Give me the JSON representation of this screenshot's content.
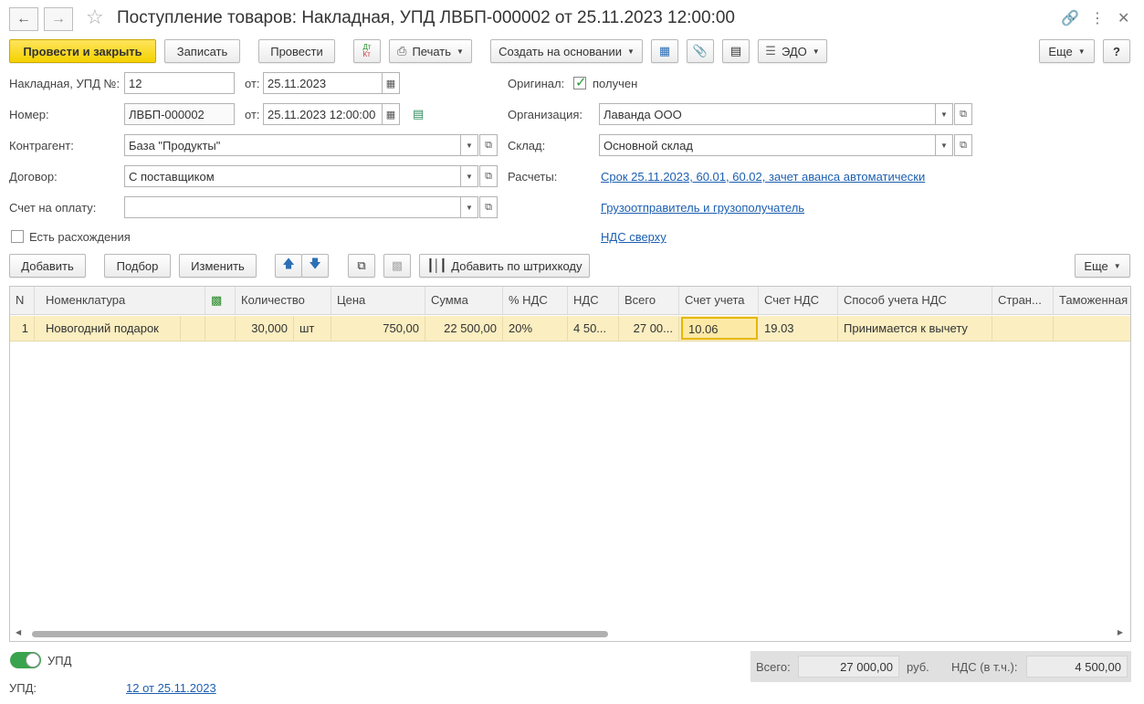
{
  "window": {
    "title": "Поступление товаров: Накладная, УПД ЛВБП-000002 от 25.11.2023 12:00:00",
    "back_icon": "arrow-left-icon",
    "forward_icon": "arrow-right-icon",
    "star_icon": "star-icon",
    "link_icon": "link-icon",
    "more_icon": "kebab-menu-icon",
    "close_icon": "close-icon"
  },
  "toolbar": {
    "post_close": "Провести и закрыть",
    "save": "Записать",
    "post": "Провести",
    "dtkt_icon": "dt-kt-icon",
    "print": "Печать",
    "create_based": "Создать на основании",
    "edo": "ЭДО",
    "more": "Еще",
    "help": "?",
    "accent": "#f5d200"
  },
  "form": {
    "invoice_label": "Накладная, УПД №:",
    "invoice_no": "12",
    "from_label": "от:",
    "invoice_date": "25.11.2023",
    "number_label": "Номер:",
    "number_value": "ЛВБП-000002",
    "doc_datetime": "25.11.2023 12:00:00",
    "contractor_label": "Контрагент:",
    "contractor_value": "База \"Продукты\"",
    "contract_label": "Договор:",
    "contract_value": "С поставщиком",
    "pay_invoice_label": "Счет на оплату:",
    "pay_invoice_value": "",
    "discrepancies_label": "Есть расхождения",
    "original_label": "Оригинал:",
    "received_label": "получен",
    "org_label": "Организация:",
    "org_value": "Лаванда ООО",
    "warehouse_label": "Склад:",
    "warehouse_value": "Основной склад",
    "settlements_label": "Расчеты:",
    "settlements_link": "Срок 25.11.2023, 60.01, 60.02, зачет аванса автоматически",
    "shipper_link": "Грузоотправитель и грузополучатель",
    "vat_link": "НДС сверху"
  },
  "table_toolbar": {
    "add": "Добавить",
    "select": "Подбор",
    "change": "Изменить",
    "barcode": "Добавить по штрихкоду",
    "more": "Еще"
  },
  "table": {
    "headers": [
      "N",
      "Номенклатура",
      "",
      "Количество",
      "",
      "Цена",
      "Сумма",
      "% НДС",
      "НДС",
      "Всего",
      "Счет учета",
      "Счет НДС",
      "Способ учета НДС",
      "Стран...",
      "Таможенная"
    ],
    "rows": [
      [
        "1",
        "Новогодний подарок",
        "",
        "30,000",
        "шт",
        "750,00",
        "22 500,00",
        "20%",
        "4 50...",
        "27 00...",
        "10.06",
        "19.03",
        "Принимается к вычету",
        "",
        ""
      ]
    ]
  },
  "footer": {
    "upd_toggle_label": "УПД",
    "upd_label": "УПД:",
    "upd_link": "12 от 25.11.2023",
    "total_label": "Всего:",
    "total_value": "27 000,00",
    "currency": "руб.",
    "vat_label": "НДС (в т.ч.):",
    "vat_value": "4 500,00"
  }
}
